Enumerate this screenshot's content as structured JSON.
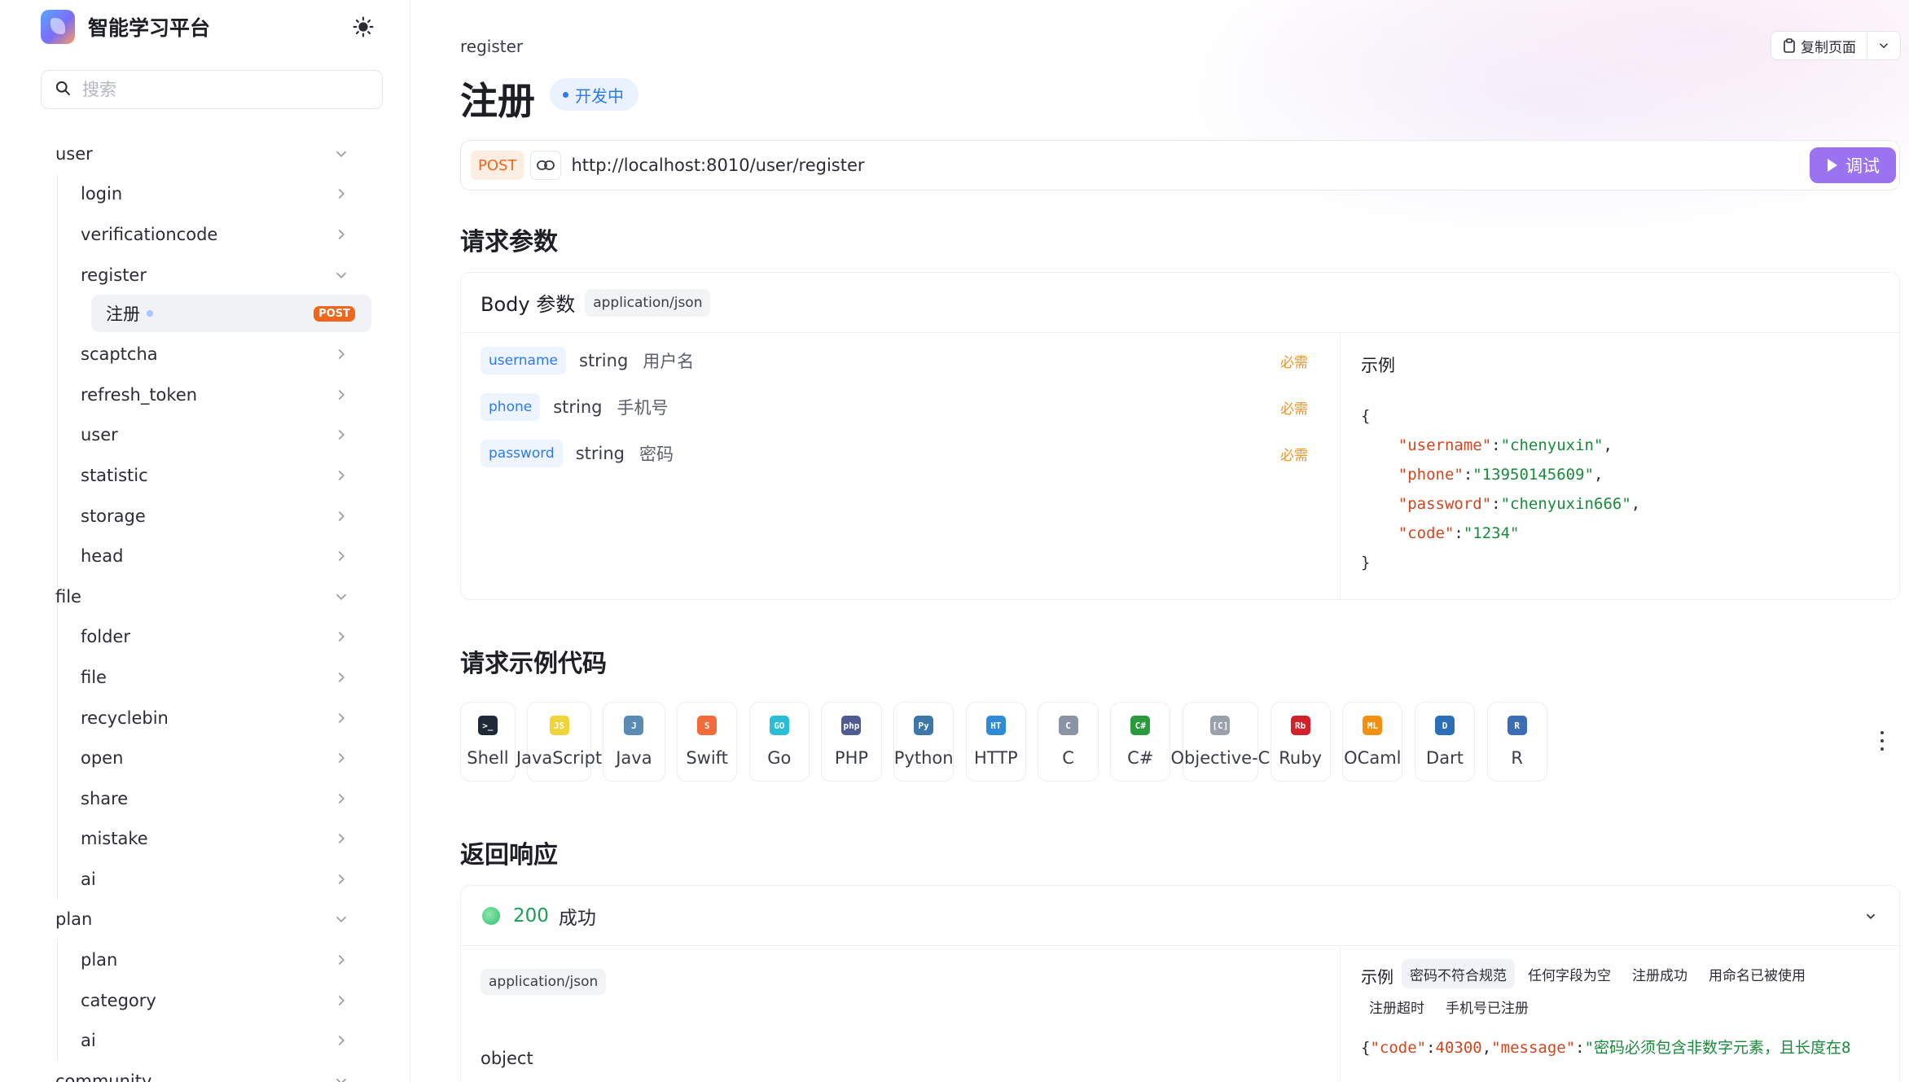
{
  "app": {
    "name": "智能学习平台"
  },
  "search": {
    "placeholder": "搜索"
  },
  "sidebar": {
    "groups": [
      {
        "label": "user",
        "items": [
          "login",
          "verificationcode",
          "register",
          "scaptcha",
          "refresh_token",
          "user",
          "statistic",
          "storage",
          "head"
        ]
      },
      {
        "label": "file",
        "items": [
          "folder",
          "file",
          "recyclebin",
          "open",
          "share",
          "mistake",
          "ai"
        ]
      },
      {
        "label": "plan",
        "items": [
          "plan",
          "category",
          "ai"
        ]
      },
      {
        "label": "community"
      }
    ],
    "active_leaf": {
      "label": "注册",
      "badge": "POST"
    }
  },
  "header": {
    "breadcrumb": "register",
    "title": "注册",
    "status": "开发中",
    "copy_page": "复制页面"
  },
  "request": {
    "method": "POST",
    "url": "http://localhost:8010/user/register",
    "debug_label": "调试"
  },
  "params_section": {
    "title": "请求参数",
    "body_label": "Body 参数",
    "content_type": "application/json",
    "params": [
      {
        "name": "username",
        "type": "string",
        "desc": "用户名",
        "required": "必需"
      },
      {
        "name": "phone",
        "type": "string",
        "desc": "手机号",
        "required": "必需"
      },
      {
        "name": "password",
        "type": "string",
        "desc": "密码",
        "required": "必需"
      }
    ],
    "example_title": "示例",
    "example": {
      "open": "{",
      "lines": [
        {
          "key": "\"username\"",
          "value": "\"chenyuxin\"",
          "sep": ","
        },
        {
          "key": "\"phone\"",
          "value": "\"13950145609\"",
          "sep": ","
        },
        {
          "key": "\"password\"",
          "value": "\"chenyuxin666\"",
          "sep": ","
        },
        {
          "key": "\"code\"",
          "value": "\"1234\"",
          "sep": ""
        }
      ],
      "close": "}"
    }
  },
  "code_section": {
    "title": "请求示例代码",
    "languages": [
      {
        "label": "Shell",
        "icon": "shell-icon",
        "color": "#1f2937",
        "glyph": ">_"
      },
      {
        "label": "JavaScript",
        "icon": "javascript-icon",
        "color": "#f0d43a",
        "glyph": "JS"
      },
      {
        "label": "Java",
        "icon": "java-icon",
        "color": "#5a8bb5",
        "glyph": "J"
      },
      {
        "label": "Swift",
        "icon": "swift-icon",
        "color": "#f26b3a",
        "glyph": "S"
      },
      {
        "label": "Go",
        "icon": "go-icon",
        "color": "#29bdd6",
        "glyph": "GO"
      },
      {
        "label": "PHP",
        "icon": "php-icon",
        "color": "#4f5b93",
        "glyph": "php"
      },
      {
        "label": "Python",
        "icon": "python-icon",
        "color": "#3b77a8",
        "glyph": "Py"
      },
      {
        "label": "HTTP",
        "icon": "http-icon",
        "color": "#2f8bd8",
        "glyph": "HT"
      },
      {
        "label": "C",
        "icon": "c-icon",
        "color": "#8a94a6",
        "glyph": "C"
      },
      {
        "label": "C#",
        "icon": "csharp-icon",
        "color": "#2a9a3f",
        "glyph": "C#"
      },
      {
        "label": "Objective-C",
        "icon": "objective-c-icon",
        "color": "#9aa1ad",
        "glyph": "[C]"
      },
      {
        "label": "Ruby",
        "icon": "ruby-icon",
        "color": "#d3212c",
        "glyph": "Rb"
      },
      {
        "label": "OCaml",
        "icon": "ocaml-icon",
        "color": "#f29111",
        "glyph": "ML"
      },
      {
        "label": "Dart",
        "icon": "dart-icon",
        "color": "#2b6fb8",
        "glyph": "D"
      },
      {
        "label": "R",
        "icon": "r-icon",
        "color": "#3a6db3",
        "glyph": "R"
      }
    ]
  },
  "response_section": {
    "title": "返回响应",
    "status_code": "200",
    "status_text": "成功",
    "content_type": "application/json",
    "schema_type": "object",
    "example_label": "示例",
    "example_tabs": [
      "密码不符合规范",
      "任何字段为空",
      "注册成功",
      "用命名已被使用",
      "注册超时",
      "手机号已注册"
    ],
    "example_line": {
      "key1": "\"code\"",
      "num": "40300",
      "key2": "\"message\"",
      "msg": "\"密码必须包含非数字元素，且长度在8"
    }
  }
}
